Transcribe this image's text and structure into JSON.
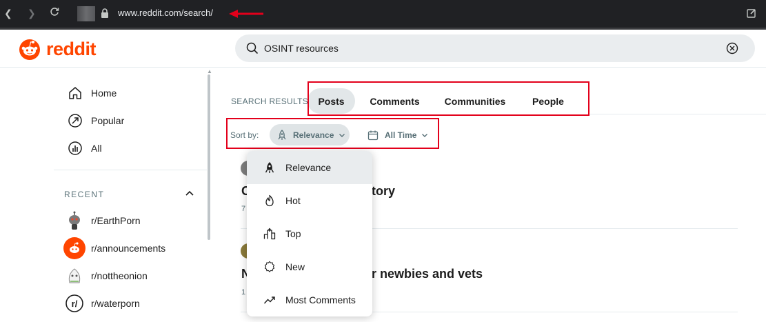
{
  "browser": {
    "url": "www.reddit.com/search/"
  },
  "header": {
    "logo_text": "reddit",
    "search_value": "OSINT resources"
  },
  "sidebar": {
    "nav": [
      {
        "label": "Home",
        "icon": "home-icon"
      },
      {
        "label": "Popular",
        "icon": "popular-icon"
      },
      {
        "label": "All",
        "icon": "all-icon"
      }
    ],
    "recent_label": "RECENT",
    "recent": [
      {
        "label": "r/EarthPorn"
      },
      {
        "label": "r/announcements"
      },
      {
        "label": "r/nottheonion"
      },
      {
        "label": "r/waterporn"
      }
    ]
  },
  "main": {
    "results_label": "SEARCH RESULTS",
    "tabs": [
      {
        "label": "Posts"
      },
      {
        "label": "Comments"
      },
      {
        "label": "Communities"
      },
      {
        "label": "People"
      }
    ],
    "sort_label": "Sort by:",
    "sort_value": "Relevance",
    "time_value": "All Time",
    "posts": [
      {
        "title_start": "O",
        "title_end": "tory",
        "meta": "7"
      },
      {
        "title_start": "N",
        "title_end": "r newbies and vets",
        "meta": "1"
      }
    ]
  },
  "dropdown": {
    "items": [
      {
        "label": "Relevance",
        "icon": "rocket-icon"
      },
      {
        "label": "Hot",
        "icon": "flame-icon"
      },
      {
        "label": "Top",
        "icon": "top-icon"
      },
      {
        "label": "New",
        "icon": "new-icon"
      },
      {
        "label": "Most Comments",
        "icon": "trend-icon"
      }
    ]
  },
  "colors": {
    "brand": "#ff4500",
    "annotation_red": "#e3001b",
    "active_pill": "#e2e7e9",
    "muted_text": "#576f76"
  }
}
